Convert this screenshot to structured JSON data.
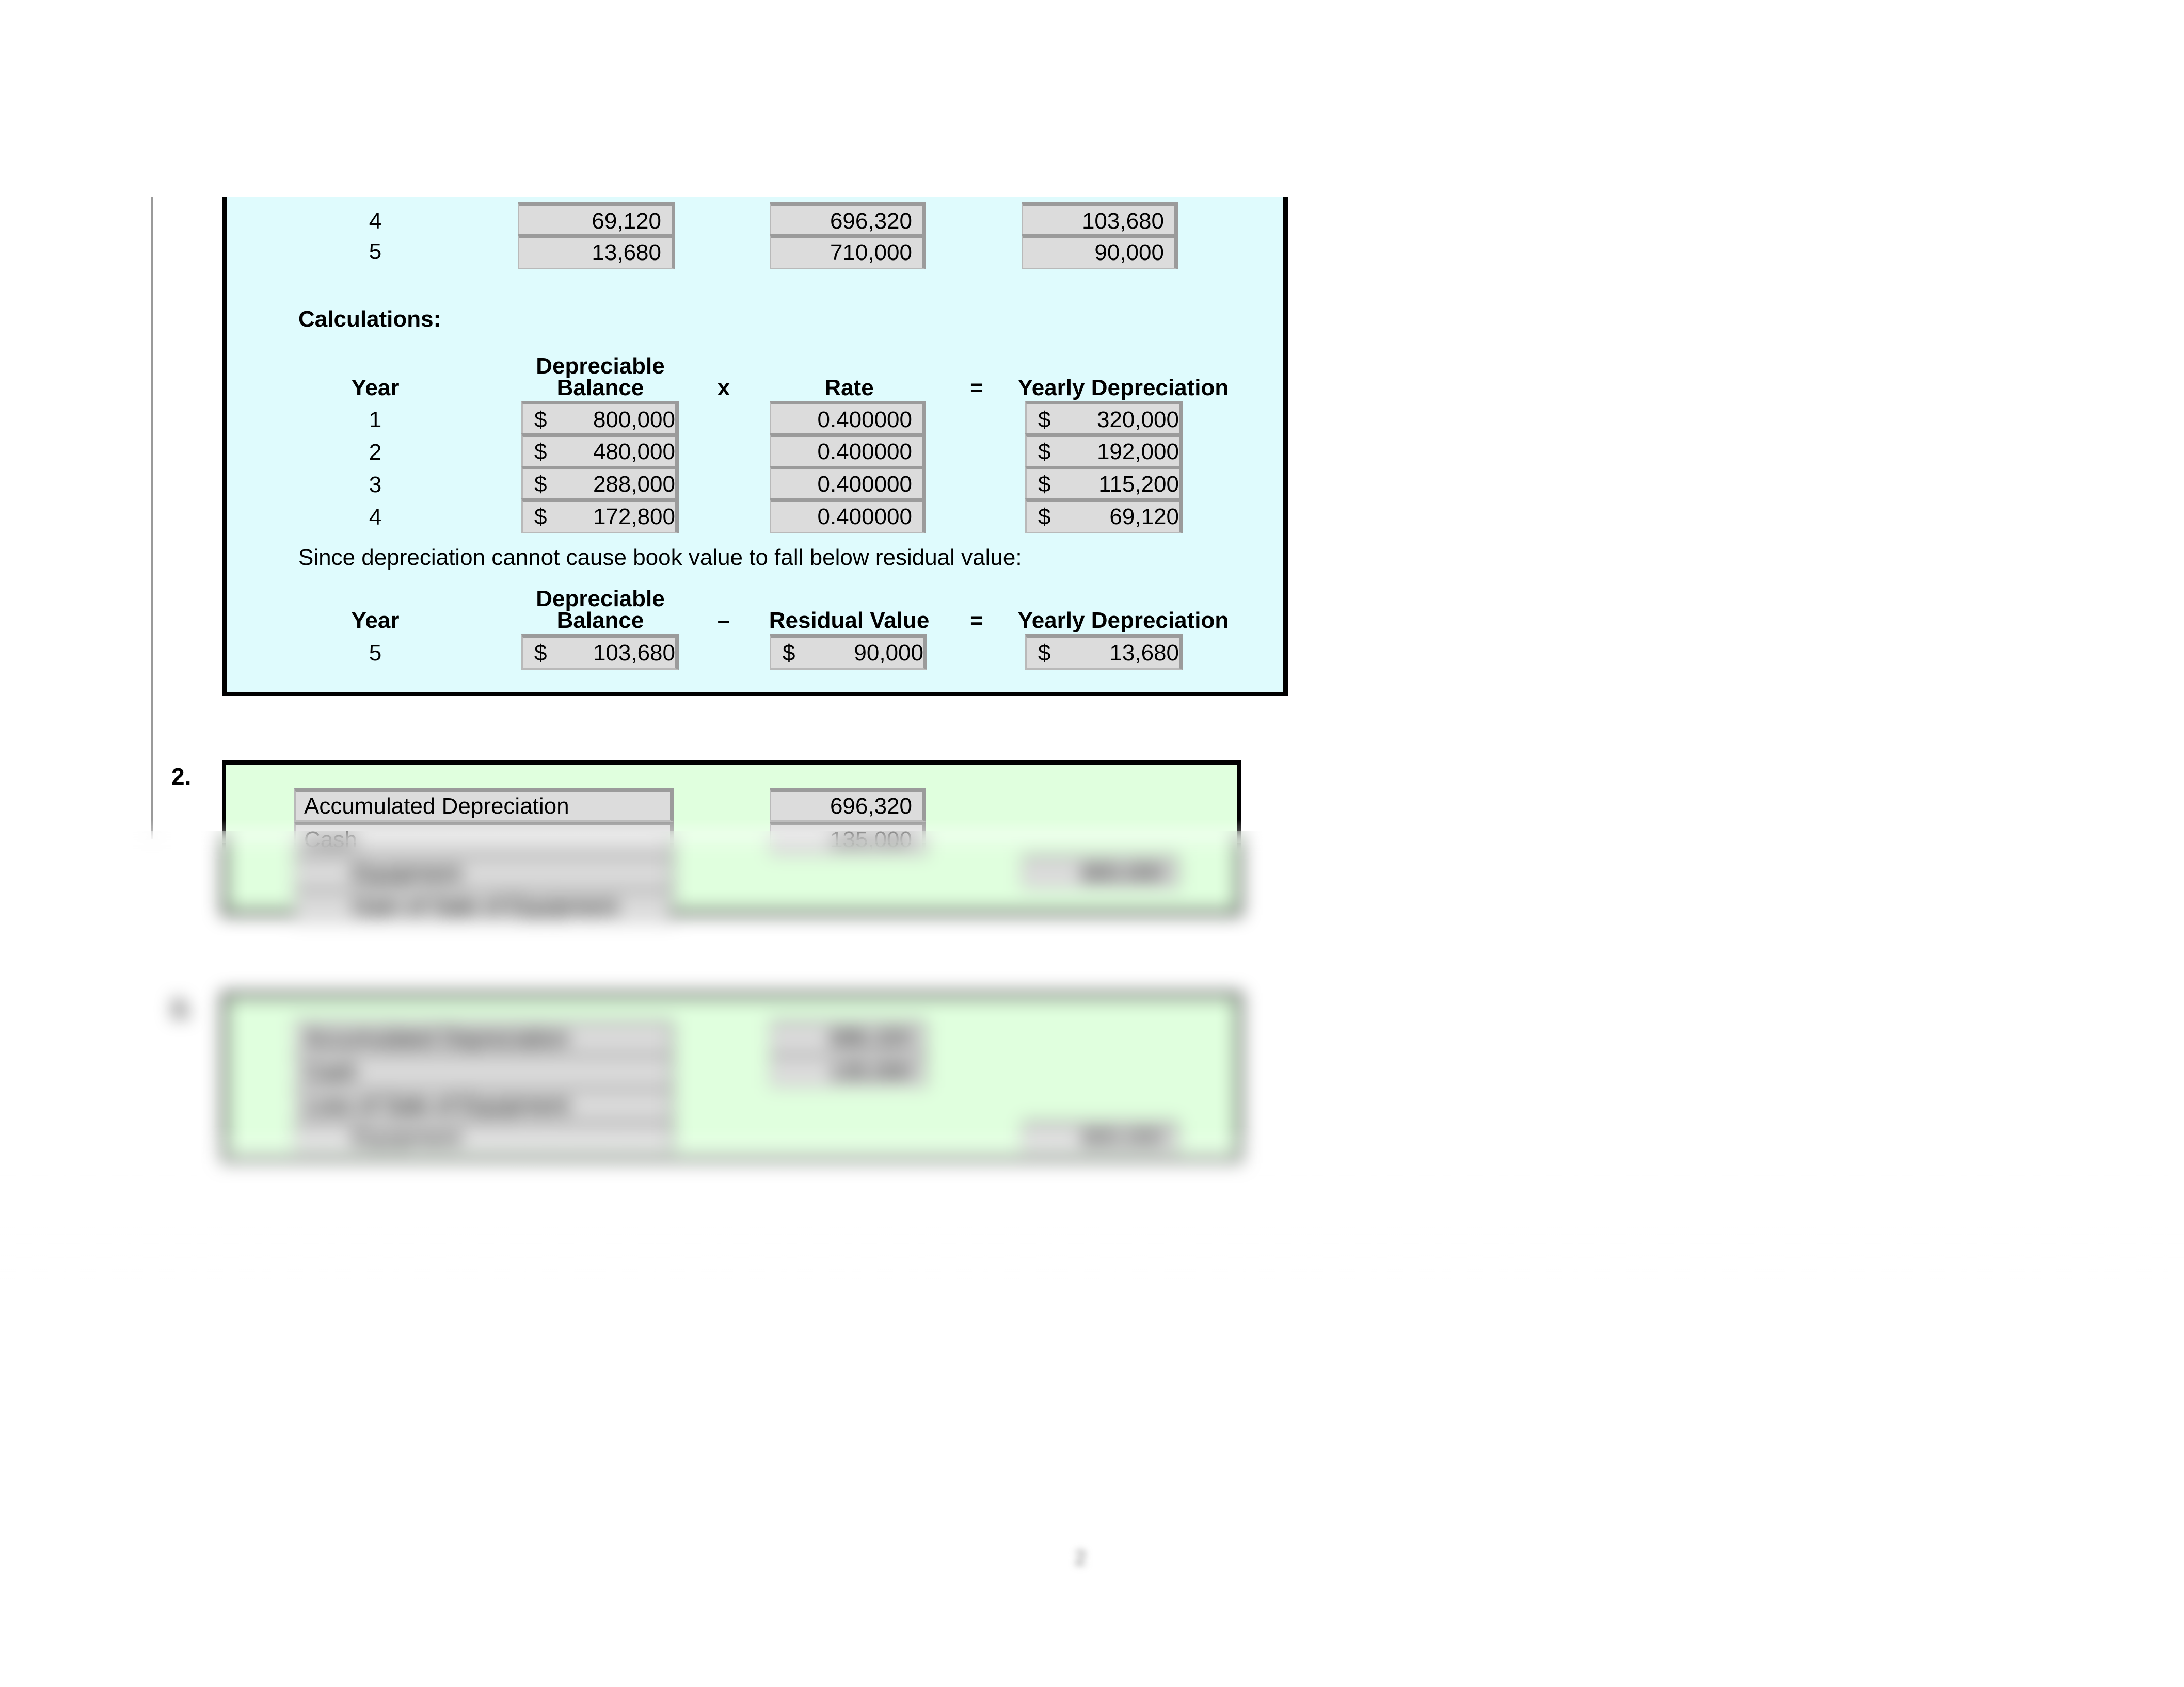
{
  "document": {
    "page_number": "2"
  },
  "schedule": {
    "visible_rows": [
      {
        "year": "4",
        "yearly_depreciation": "69,120",
        "accumulated_depreciation": "696,320",
        "book_value": "103,680"
      },
      {
        "year": "5",
        "yearly_depreciation": "13,680",
        "accumulated_depreciation": "710,000",
        "book_value": "90,000"
      }
    ]
  },
  "calculations": {
    "heading": "Calculations:",
    "declining_balance": {
      "headers": {
        "year": "Year",
        "depreciable_balance_line1": "Depreciable",
        "depreciable_balance_line2": "Balance",
        "operator_multiply": "x",
        "rate": "Rate",
        "operator_equals": "=",
        "yearly_depreciation": "Yearly Depreciation"
      },
      "rows": [
        {
          "year": "1",
          "balance_symbol": "$",
          "balance": "800,000",
          "rate": "0.400000",
          "dep_symbol": "$",
          "depreciation": "320,000"
        },
        {
          "year": "2",
          "balance_symbol": "$",
          "balance": "480,000",
          "rate": "0.400000",
          "dep_symbol": "$",
          "depreciation": "192,000"
        },
        {
          "year": "3",
          "balance_symbol": "$",
          "balance": "288,000",
          "rate": "0.400000",
          "dep_symbol": "$",
          "depreciation": "115,200"
        },
        {
          "year": "4",
          "balance_symbol": "$",
          "balance": "172,800",
          "rate": "0.400000",
          "dep_symbol": "$",
          "depreciation": "69,120"
        }
      ]
    },
    "note": "Since depreciation cannot cause book value to fall below residual value:",
    "residual_limit": {
      "headers": {
        "year": "Year",
        "depreciable_balance_line1": "Depreciable",
        "depreciable_balance_line2": "Balance",
        "operator_minus": "–",
        "residual_value": "Residual Value",
        "operator_equals": "=",
        "yearly_depreciation": "Yearly Depreciation"
      },
      "rows": [
        {
          "year": "5",
          "balance_symbol": "$",
          "balance": "103,680",
          "residual_symbol": "$",
          "residual": "90,000",
          "dep_symbol": "$",
          "depreciation": "13,680"
        }
      ]
    }
  },
  "entry_2": {
    "number": "2.",
    "rows": [
      {
        "account": "Accumulated Depreciation",
        "debit": "696,320",
        "credit": ""
      },
      {
        "account": "Cash",
        "debit": "135,000",
        "credit": ""
      },
      {
        "account": "Equipment",
        "debit": "",
        "credit": "800,000"
      },
      {
        "account": "Gain of Sale of Equipment",
        "debit": "",
        "credit": ""
      }
    ]
  },
  "entry_3": {
    "number": "3.",
    "rows": [
      {
        "account": "Accumulated Depreciation",
        "debit": "696,320",
        "credit": ""
      },
      {
        "account": "Cash",
        "debit": "135,000",
        "credit": ""
      },
      {
        "account": "Loss of Sale of Equipment",
        "debit": "",
        "credit": ""
      },
      {
        "account": "Equipment",
        "debit": "",
        "credit": "800,000"
      }
    ]
  },
  "colors": {
    "panel_cyan": "#dffbfd",
    "panel_green": "#e0ffde",
    "cell_fill": "#dcdcdc",
    "cell_border": "#9b9b9b"
  }
}
